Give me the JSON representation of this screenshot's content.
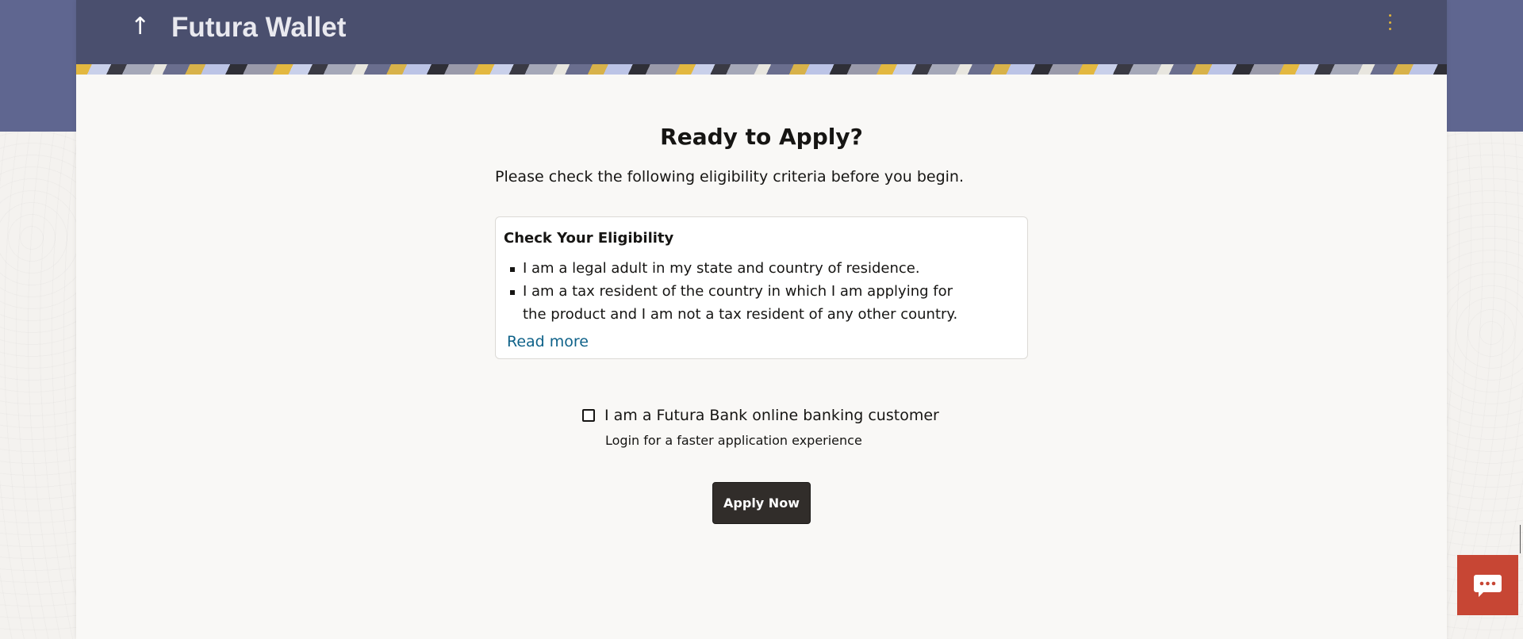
{
  "header": {
    "app_title": "Futura Wallet",
    "back_icon": "up-arrow-icon",
    "menu_icon": "kebab-menu-icon",
    "accent_color": "#e0b23a"
  },
  "main": {
    "heading": "Ready to Apply?",
    "intro": "Please check the following eligibility criteria before you begin.",
    "eligibility_card": {
      "title": "Check Your Eligibility",
      "criteria": [
        "I am a legal adult in my state and country of residence.",
        "I am a tax resident of the country in which I am applying for the product and I am not a tax resident of any other country."
      ],
      "read_more": "Read more"
    },
    "customer_checkbox": {
      "label": "I am a Futura Bank online banking customer",
      "checked": false,
      "helper": "Login for a faster application experience"
    },
    "apply_button": "Apply Now"
  },
  "chat": {
    "icon": "chat-bubble-icon",
    "color": "#c74634"
  },
  "colors": {
    "header_bg": "#4a4f6e",
    "band_bg": "#5f6690",
    "button_bg": "#312d2a",
    "link": "#0f6289"
  }
}
